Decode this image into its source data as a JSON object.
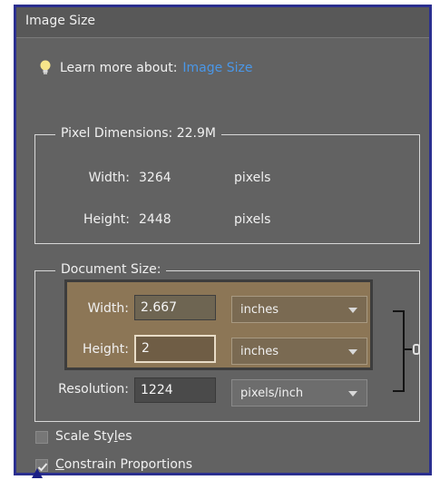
{
  "window": {
    "title": "Image Size"
  },
  "learn_more": {
    "prefix": "Learn more about:",
    "link": "Image Size"
  },
  "pixel_dimensions": {
    "legend": "Pixel Dimensions:  22.9M",
    "width_label": "Width:",
    "width_value": "3264",
    "width_unit": "pixels",
    "height_label": "Height:",
    "height_value": "2448",
    "height_unit": "pixels"
  },
  "document_size": {
    "legend": "Document Size:",
    "width_label": "Width:",
    "width_value": "2.667",
    "width_unit": "inches",
    "height_label": "Height:",
    "height_value": "2",
    "height_unit": "inches",
    "resolution_label": "Resolution:",
    "resolution_value": "1224",
    "resolution_unit": "pixels/inch"
  },
  "options": {
    "scale_styles_a": "Scale Sty",
    "scale_styles_u": "l",
    "scale_styles_b": "es",
    "constrain_u": "C",
    "constrain_rest": "onstrain Proportions"
  },
  "colors": {
    "panel_bg": "#626262",
    "highlight": "#8c7656",
    "link": "#4a97e8",
    "frame_border": "#2b2f8f"
  }
}
